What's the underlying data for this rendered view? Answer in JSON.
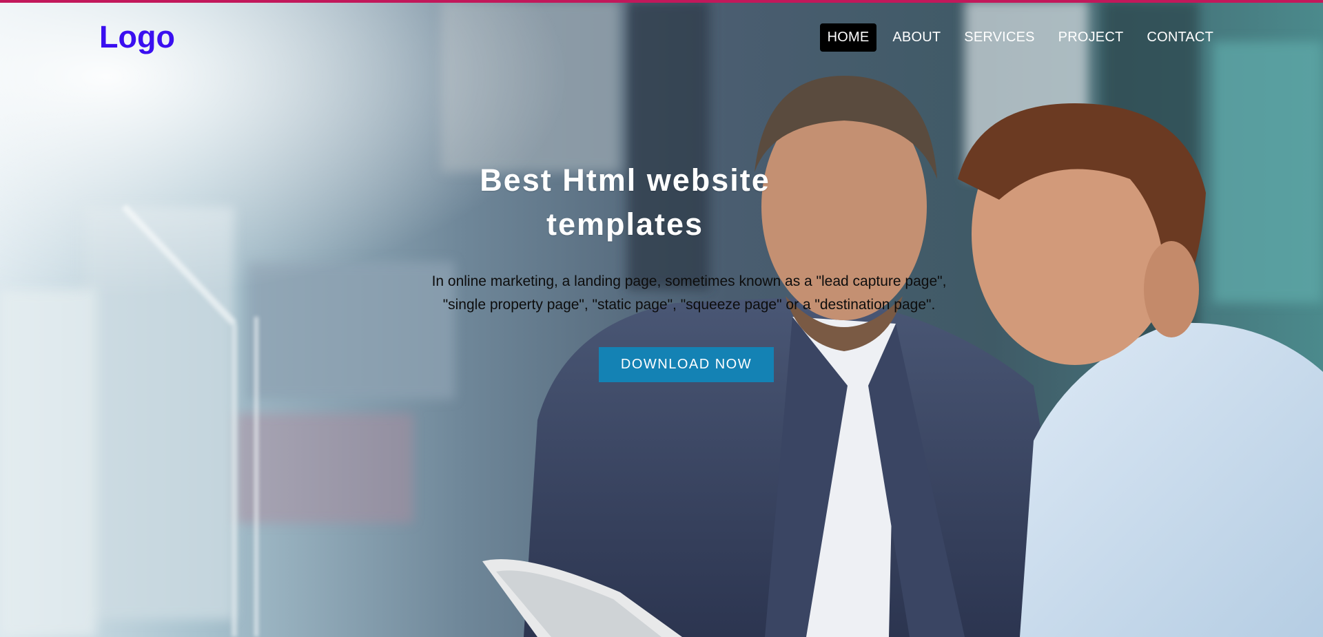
{
  "brand": {
    "logo_text": "Logo",
    "logo_color": "#3a0ff0",
    "accent_bar_color": "#c2185b"
  },
  "nav": {
    "items": [
      {
        "label": "HOME",
        "active": true
      },
      {
        "label": "ABOUT",
        "active": false
      },
      {
        "label": "SERVICES",
        "active": false
      },
      {
        "label": "PROJECT",
        "active": false
      },
      {
        "label": "CONTACT",
        "active": false
      }
    ]
  },
  "hero": {
    "title_line1": "Best Html website",
    "title_line2": "templates",
    "description_line1": "In online marketing, a landing page, sometimes known as a \"lead capture page\",",
    "description_line2": "\"single property page\", \"static page\", \"squeeze page\" or a \"destination page\".",
    "cta_label": "DOWNLOAD NOW",
    "cta_color": "#1482b4",
    "background_image": "two-businessmen-looking-at-tablet-photo"
  }
}
